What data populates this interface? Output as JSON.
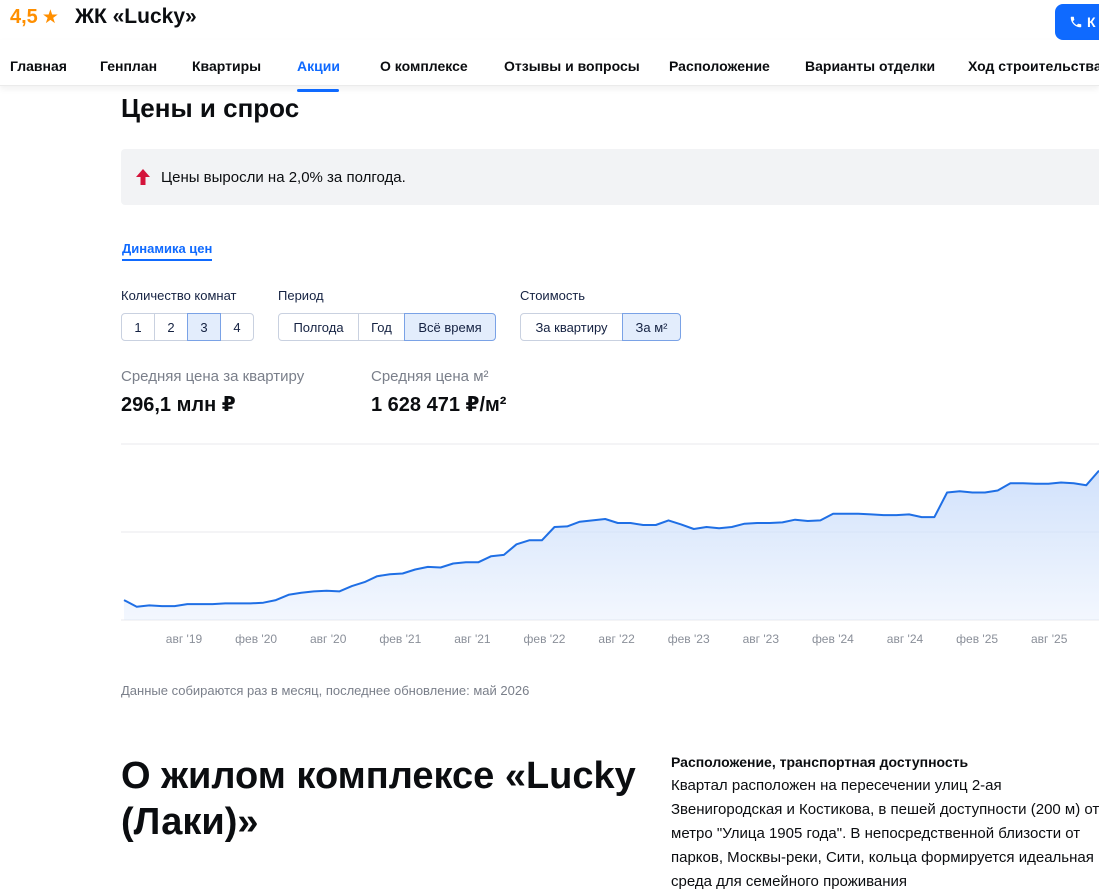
{
  "header": {
    "rating": "4,5",
    "title": "ЖК «Lucky»",
    "call_label": "К"
  },
  "nav": {
    "items": [
      {
        "label": "Главная"
      },
      {
        "label": "Генплан"
      },
      {
        "label": "Квартиры"
      },
      {
        "label": "Акции"
      },
      {
        "label": "О комплексе"
      },
      {
        "label": "Отзывы и вопросы"
      },
      {
        "label": "Расположение"
      },
      {
        "label": "Варианты отделки"
      },
      {
        "label": "Ход строительства"
      }
    ],
    "active": "Акции"
  },
  "prices": {
    "heading": "Цены и спрос",
    "notice": "Цены выросли на 2,0% за полгода.",
    "tab": "Динамика цен",
    "rooms_label": "Количество комнат",
    "rooms": [
      "1",
      "2",
      "3",
      "4"
    ],
    "rooms_selected": "3",
    "period_label": "Период",
    "periods": [
      "Полгода",
      "Год",
      "Всё время"
    ],
    "period_selected": "Всё время",
    "cost_label": "Стоимость",
    "costs": [
      "За квартиру",
      "За м²"
    ],
    "cost_selected": "За м²",
    "avg_flat_label": "Средняя цена за квартиру",
    "avg_flat_value": "296,1 млн ₽",
    "avg_sqm_label": "Средняя цена м²",
    "avg_sqm_value": "1 628 471 ₽/м²",
    "updated": "Данные собираются раз в месяц, последнее обновление: май 2026"
  },
  "chart_data": {
    "type": "area",
    "title": "",
    "xlabel": "",
    "ylabel": "",
    "x_ticks": [
      "авг '19",
      "фев '20",
      "авг '20",
      "фев '21",
      "авг '21",
      "фев '22",
      "авг '22",
      "фев '23",
      "авг '23",
      "фев '24",
      "авг '24",
      "фев '25",
      "авг '25"
    ],
    "grid": true,
    "series": [
      {
        "values": [
          1160,
          1150,
          1152,
          1151,
          1151,
          1154,
          1154,
          1154,
          1155,
          1155,
          1155,
          1156,
          1160,
          1168,
          1171,
          1173,
          1174,
          1173,
          1181,
          1187,
          1196,
          1199,
          1200,
          1206,
          1210,
          1209,
          1215,
          1217,
          1217,
          1226,
          1228,
          1244,
          1250,
          1250,
          1270,
          1271,
          1278,
          1280,
          1282,
          1276,
          1276,
          1273,
          1273,
          1280,
          1274,
          1267,
          1270,
          1268,
          1270,
          1275,
          1276,
          1276,
          1277,
          1281,
          1279,
          1280,
          1290,
          1290,
          1290,
          1289,
          1288,
          1288,
          1289,
          1285,
          1285,
          1322,
          1324,
          1322,
          1322,
          1325,
          1336,
          1336,
          1335,
          1335,
          1337,
          1336,
          1333,
          1355
        ]
      }
    ],
    "color": "#1f6fe5",
    "fill": "#cfe0fb",
    "ylim": [
      1130,
      1395
    ]
  },
  "about": {
    "heading": "О жилом комплексе «Lucky (Лаки)»",
    "location_title": "Расположение, транспортная доступность",
    "location_text": "Квартал расположен на пересечении улиц 2-ая Звенигородская и Костикова, в пешей доступности (200 м) от метро \"Улица 1905 года\". В непосредственной близости от парков, Москвы-реки, Сити, кольца формируется идеальная среда для семейного проживания"
  },
  "colors": {
    "accent": "#0f6aff",
    "rating": "#ff8f00",
    "up_arrow": "#d4143b"
  }
}
